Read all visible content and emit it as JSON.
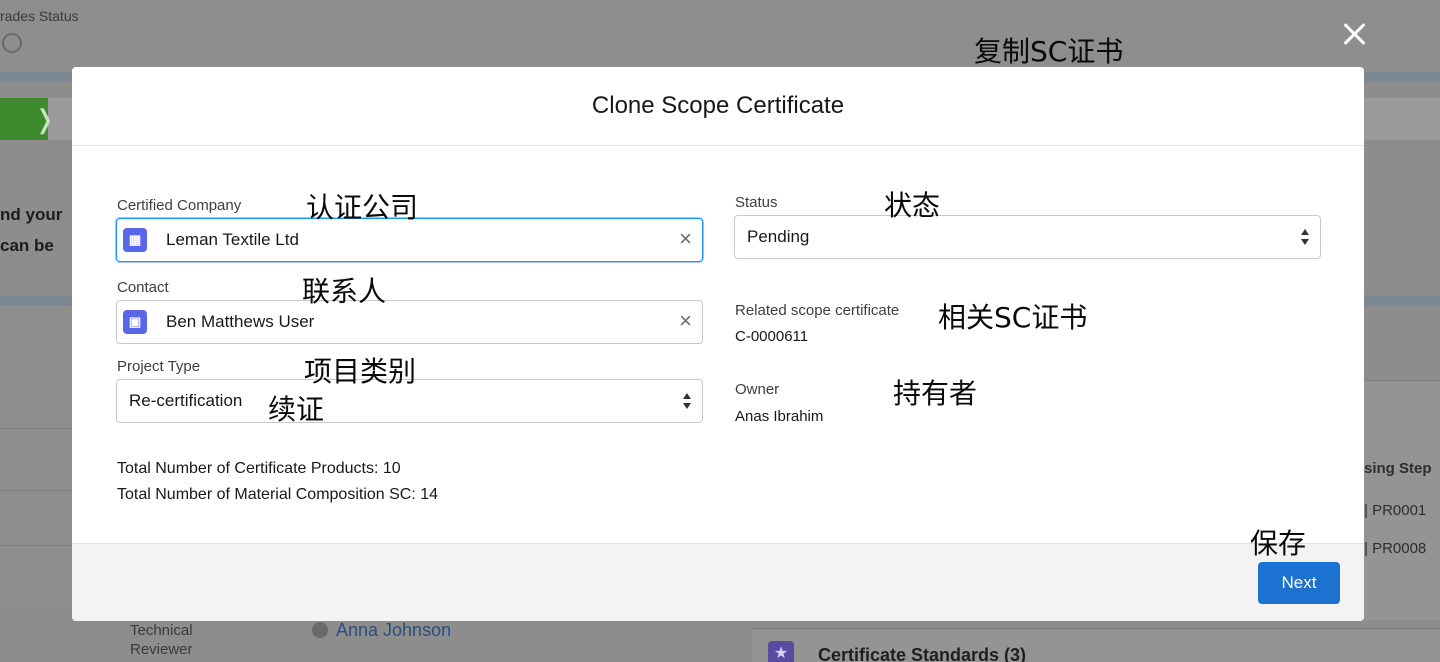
{
  "background": {
    "title": "rades Status",
    "left_text_1": "nd your",
    "left_text_2": "can be",
    "right_text_1": "sing Step",
    "right_text_2": "| PR0001",
    "right_text_3": "| PR0008",
    "reviewer_label_1": "Technical",
    "reviewer_label_2": "Reviewer",
    "reviewer_name": "Anna Johnson",
    "certificate_standards_title": "Certificate Standards (3)"
  },
  "modal": {
    "title": "Clone Scope Certificate",
    "certified_company": {
      "label": "Certified Company",
      "value": "Leman Textile Ltd"
    },
    "contact": {
      "label": "Contact",
      "value": "Ben Matthews User"
    },
    "project_type": {
      "label": "Project Type",
      "value": "Re-certification"
    },
    "status": {
      "label": "Status",
      "value": "Pending"
    },
    "related_scope_certificate": {
      "label": "Related scope certificate",
      "value": "C-0000611"
    },
    "owner": {
      "label": "Owner",
      "value": "Anas Ibrahim"
    },
    "total_products": "Total Number of Certificate Products: 10",
    "total_material": "Total Number of Material Composition SC: 14",
    "next_label": "Next"
  },
  "annotations": {
    "title_cn": "复制SC证书",
    "company_cn": "认证公司",
    "contact_cn": "联系人",
    "project_type_cn": "项目类别",
    "recert_cn": "续证",
    "status_cn": "状态",
    "related_cn": "相关SC证书",
    "owner_cn": "持有者",
    "save_cn": "保存"
  },
  "colors": {
    "primary_button": "#1b72d0",
    "lookup_icon": "#5867e8",
    "focus_border": "#1b96ff",
    "overlay_gray": "#8d8d8d"
  },
  "icons": [
    "close-icon",
    "company-icon",
    "contact-card-icon",
    "clear-icon",
    "picklist-arrows-icon",
    "star-icon",
    "user-avatar-icon"
  ]
}
